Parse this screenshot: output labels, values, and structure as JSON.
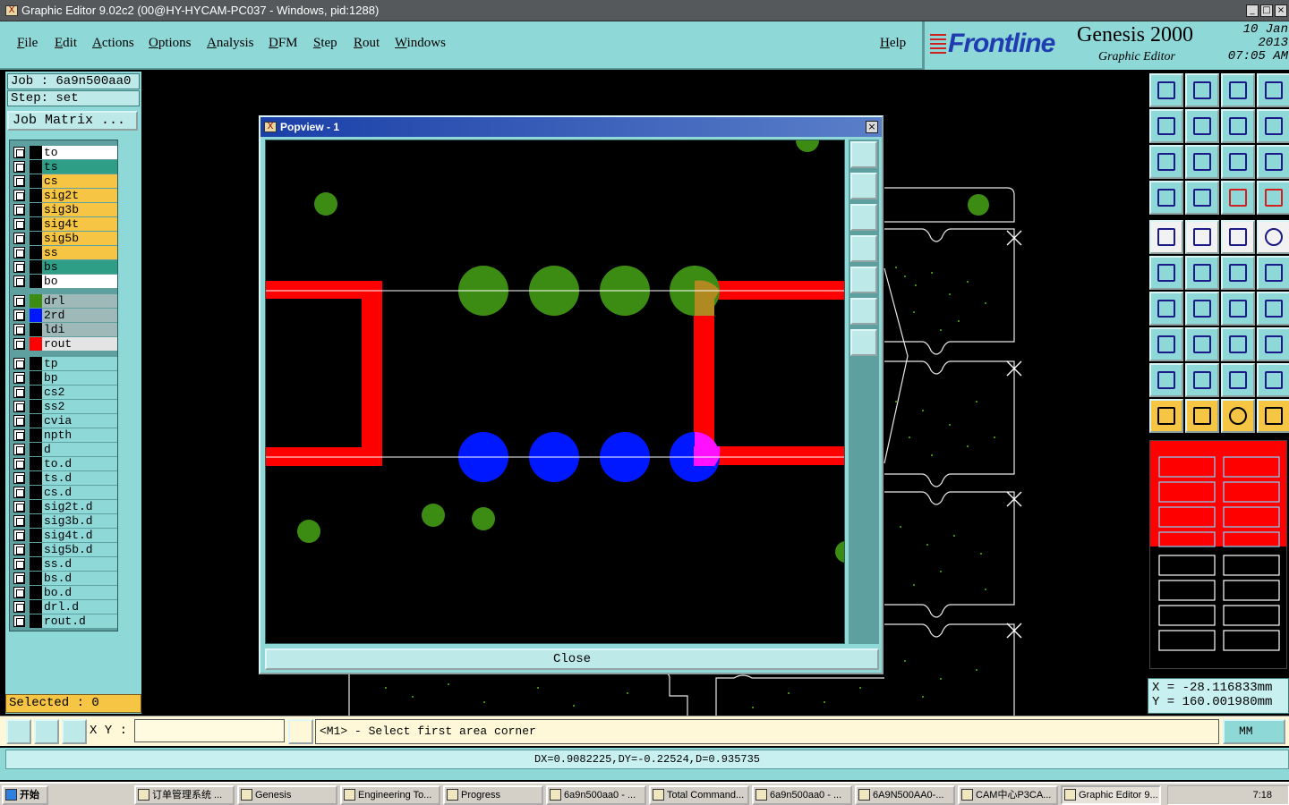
{
  "window": {
    "title": "Graphic Editor 9.02c2 (00@HY-HYCAM-PC037 - Windows, pid:1288)"
  },
  "menu": {
    "file": "File",
    "edit": "Edit",
    "actions": "Actions",
    "options": "Options",
    "analysis": "Analysis",
    "dfm": "DFM",
    "step": "Step",
    "rout": "Rout",
    "windows": "Windows",
    "help": "Help"
  },
  "brand": {
    "logo": "Frontline",
    "product": "Genesis 2000",
    "sub": "Graphic Editor",
    "date": "10 Jan 2013",
    "time": "07:05 AM"
  },
  "job": {
    "job_label": "Job : 6a9n500aa0",
    "step_label": "Step: set",
    "matrix_button": "Job Matrix ..."
  },
  "layers": [
    {
      "name": "to",
      "color": "#ffffff",
      "swatch": "#000000"
    },
    {
      "name": "ts",
      "color": "#2e9e86",
      "swatch": "#000000"
    },
    {
      "name": "cs",
      "color": "#f7c544",
      "swatch": "#000000"
    },
    {
      "name": "sig2t",
      "color": "#f7c544",
      "swatch": "#000000"
    },
    {
      "name": "sig3b",
      "color": "#f7c544",
      "swatch": "#000000"
    },
    {
      "name": "sig4t",
      "color": "#f7c544",
      "swatch": "#000000"
    },
    {
      "name": "sig5b",
      "color": "#f7c544",
      "swatch": "#000000"
    },
    {
      "name": "ss",
      "color": "#f7c544",
      "swatch": "#000000"
    },
    {
      "name": "bs",
      "color": "#2e9e86",
      "swatch": "#000000"
    },
    {
      "name": "bo",
      "color": "#ffffff",
      "swatch": "#000000"
    },
    {
      "name": "drl",
      "color": "#9fb8b8",
      "swatch": "#3c8c14"
    },
    {
      "name": "2rd",
      "color": "#9fb8b8",
      "swatch": "#0018ff"
    },
    {
      "name": "ldi",
      "color": "#9fb8b8",
      "swatch": "#000000"
    },
    {
      "name": "rout",
      "color": "#e4e4e4",
      "swatch": "#ff0000"
    },
    {
      "name": "tp",
      "color": "#8fd8d8",
      "swatch": "#000000"
    },
    {
      "name": "bp",
      "color": "#8fd8d8",
      "swatch": "#000000"
    },
    {
      "name": "cs2",
      "color": "#8fd8d8",
      "swatch": "#000000"
    },
    {
      "name": "ss2",
      "color": "#8fd8d8",
      "swatch": "#000000"
    },
    {
      "name": "cvia",
      "color": "#8fd8d8",
      "swatch": "#000000"
    },
    {
      "name": "npth",
      "color": "#8fd8d8",
      "swatch": "#000000"
    },
    {
      "name": "d",
      "color": "#8fd8d8",
      "swatch": "#000000"
    },
    {
      "name": "to.d",
      "color": "#8fd8d8",
      "swatch": "#000000"
    },
    {
      "name": "ts.d",
      "color": "#8fd8d8",
      "swatch": "#000000"
    },
    {
      "name": "cs.d",
      "color": "#8fd8d8",
      "swatch": "#000000"
    },
    {
      "name": "sig2t.d",
      "color": "#8fd8d8",
      "swatch": "#000000"
    },
    {
      "name": "sig3b.d",
      "color": "#8fd8d8",
      "swatch": "#000000"
    },
    {
      "name": "sig4t.d",
      "color": "#8fd8d8",
      "swatch": "#000000"
    },
    {
      "name": "sig5b.d",
      "color": "#8fd8d8",
      "swatch": "#000000"
    },
    {
      "name": "ss.d",
      "color": "#8fd8d8",
      "swatch": "#000000"
    },
    {
      "name": "bs.d",
      "color": "#8fd8d8",
      "swatch": "#000000"
    },
    {
      "name": "bo.d",
      "color": "#8fd8d8",
      "swatch": "#000000"
    },
    {
      "name": "drl.d",
      "color": "#8fd8d8",
      "swatch": "#000000"
    },
    {
      "name": "rout.d",
      "color": "#8fd8d8",
      "swatch": "#000000"
    }
  ],
  "selected": "Selected : 0",
  "popview": {
    "title": "Popview - 1",
    "close": "Close"
  },
  "coords": {
    "x": "X = -28.116833mm",
    "y": "Y = 160.001980mm"
  },
  "command": {
    "xy_label": "X Y :",
    "prompt": "<M1> - Select first area corner",
    "units": "MM"
  },
  "status": {
    "measure": "DX=0.9082225,DY=-0.22524,D=0.935735"
  },
  "taskbar": {
    "start": "开始",
    "tasks": [
      "订单管理系统 ...",
      "Genesis",
      "Engineering To...",
      "Progress",
      "6a9n500aa0 - ...",
      "Total Command...",
      "6a9n500aa0 - ...",
      "6A9N500AA0-...",
      "CAM中心P3CA...",
      "Graphic Editor 9..."
    ],
    "clock": "7:18"
  }
}
